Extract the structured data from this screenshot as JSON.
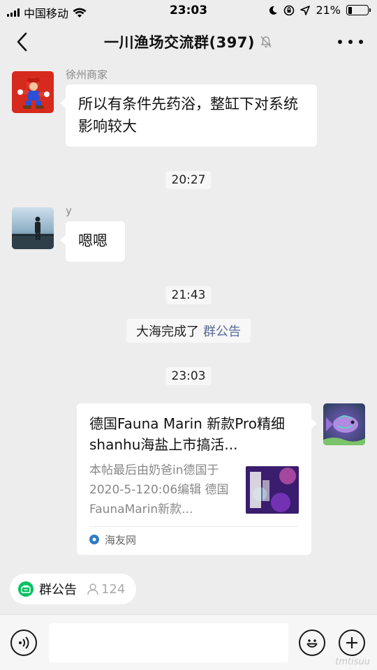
{
  "status_bar": {
    "carrier": "中国移动",
    "time": "23:03",
    "battery": "21%",
    "battery_level": 0.21
  },
  "nav": {
    "title": "一川渔场交流群(397)",
    "icons": [
      "back-icon",
      "mute-bell-icon",
      "more-icon"
    ]
  },
  "messages": [
    {
      "sender": "徐州商家",
      "text": "所以有条件先药浴，整缸下对系统影响较大"
    },
    {
      "time": "20:27"
    },
    {
      "sender": "y",
      "text": "嗯嗯"
    },
    {
      "time": "21:43"
    },
    {
      "system_text": "大海完成了",
      "system_link": "群公告"
    },
    {
      "time": "23:03"
    },
    {
      "card": {
        "title": "德国Fauna Marin 新款Pro精细shanhu海盐上市搞活...",
        "description": "本帖最后由奶爸in德国于2020-5-120:06编辑 德国FaunaMarin新款...",
        "source": "海友网"
      }
    }
  ],
  "announcement": {
    "label": "群公告",
    "count": "124"
  },
  "input_bar": {
    "placeholder": "",
    "icons": [
      "voice-icon",
      "emoji-icon",
      "plus-icon"
    ]
  },
  "watermark": "tmtisuu",
  "colors": {
    "background": "#ededed",
    "bubble": "#ffffff",
    "link": "#576b95",
    "accent_green": "#07c160"
  }
}
